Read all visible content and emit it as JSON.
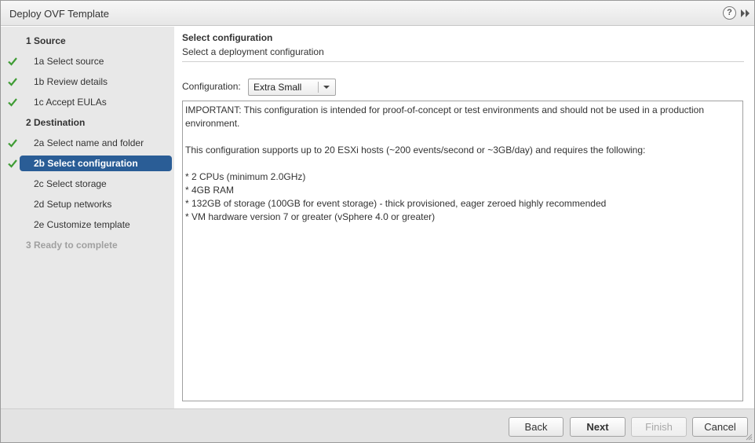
{
  "window": {
    "title": "Deploy OVF Template",
    "help_symbol": "?",
    "icons": [
      "help-icon",
      "expand-icon"
    ]
  },
  "nav": {
    "items": [
      {
        "label": "1  Source",
        "state": "section",
        "checked": false
      },
      {
        "label": "1a  Select source",
        "state": "done",
        "checked": true
      },
      {
        "label": "1b  Review details",
        "state": "done",
        "checked": true
      },
      {
        "label": "1c  Accept EULAs",
        "state": "done",
        "checked": true
      },
      {
        "label": "2  Destination",
        "state": "section",
        "checked": false
      },
      {
        "label": "2a  Select name and folder",
        "state": "done",
        "checked": true
      },
      {
        "label": "2b  Select configuration",
        "state": "current",
        "checked": true
      },
      {
        "label": "2c  Select storage",
        "state": "pending",
        "checked": false
      },
      {
        "label": "2d  Setup networks",
        "state": "pending",
        "checked": false
      },
      {
        "label": "2e  Customize template",
        "state": "pending",
        "checked": false
      },
      {
        "label": "3  Ready to complete",
        "state": "disabled",
        "checked": false
      }
    ]
  },
  "content": {
    "heading": "Select configuration",
    "subheading": "Select a deployment configuration",
    "configuration": {
      "label": "Configuration:",
      "selected": "Extra Small"
    },
    "description": {
      "lines": [
        "IMPORTANT: This configuration is intended for proof-of-concept or test environments and should not be used in a production environment.",
        "",
        "This configuration supports up to 20 ESXi hosts (~200 events/second or ~3GB/day) and requires the following:",
        "",
        "* 2 CPUs (minimum 2.0GHz)",
        "* 4GB RAM",
        "* 132GB of storage (100GB for event storage) - thick provisioned, eager zeroed highly recommended",
        "* VM hardware version 7 or greater (vSphere 4.0 or greater)"
      ]
    }
  },
  "footer": {
    "back_label": "Back",
    "next_label": "Next",
    "finish_label": "Finish",
    "cancel_label": "Cancel"
  },
  "colors": {
    "check_green": "#3f9c35",
    "selected_blue": "#2a5d96",
    "nav_bg": "#e8e8e8"
  }
}
